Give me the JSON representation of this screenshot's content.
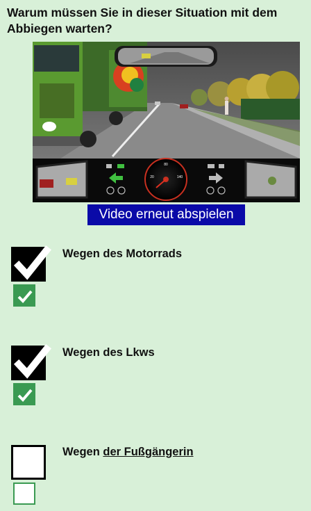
{
  "question": {
    "text": "Warum müssen Sie in dieser Situation mit dem Abbiegen warten?"
  },
  "video": {
    "replay_label": "Video erneut abspielen"
  },
  "answers": [
    {
      "prefix": "Wegen des Motorrads",
      "link": "",
      "checked": true,
      "verified": true
    },
    {
      "prefix": "Wegen des Lkws",
      "link": "",
      "checked": true,
      "verified": true
    },
    {
      "prefix": "Wegen ",
      "link": "der Fußgängerin",
      "checked": false,
      "verified": false
    }
  ],
  "colors": {
    "background": "#d8f0d8",
    "replay_button": "#0a0aa8",
    "verify_green": "#3a9a52"
  },
  "icons": [
    "checkmark-icon",
    "speedometer-icon",
    "turn-signal-left-icon",
    "turn-signal-right-icon",
    "rear-view-mirror",
    "side-mirror-left",
    "side-mirror-right"
  ]
}
